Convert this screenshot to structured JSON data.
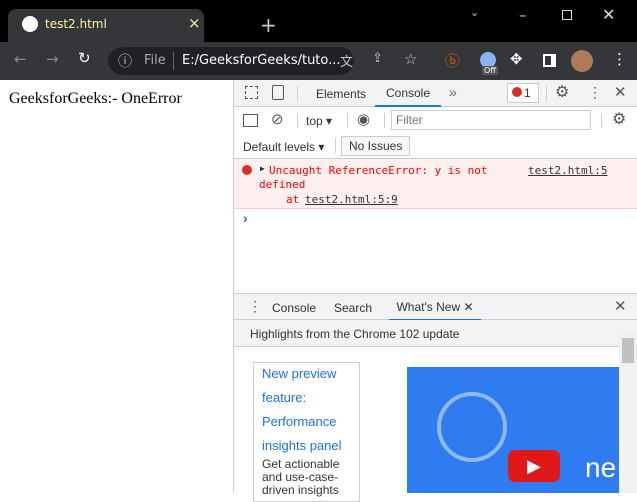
{
  "browser": {
    "tab_title": "test2.html",
    "address_scheme": "File",
    "address": "E:/GeeksforGeeks/tuto...",
    "ext_badge": "Off"
  },
  "page": {
    "text": "GeeksforGeeks:- OneError"
  },
  "devtools": {
    "tabs": [
      "Elements",
      "Console"
    ],
    "more": "»",
    "error_count": "1",
    "context": "top",
    "filter_placeholder": "Filter",
    "levels": "Default levels",
    "issues": "No Issues",
    "error": {
      "message": "Uncaught ReferenceError: y is not",
      "message2": "defined",
      "source": "test2.html:5",
      "at": "at",
      "at_link": "test2.html:5:9"
    },
    "prompt": "›",
    "drawer": {
      "tabs": [
        "Console",
        "Search",
        "What's New"
      ],
      "highlights": "Highlights from the Chrome 102 update",
      "card_title": [
        "New preview",
        "feature:",
        "Performance",
        "insights panel"
      ],
      "card_body": "Get actionable and use-case-driven insights",
      "video_text": "ne"
    }
  }
}
